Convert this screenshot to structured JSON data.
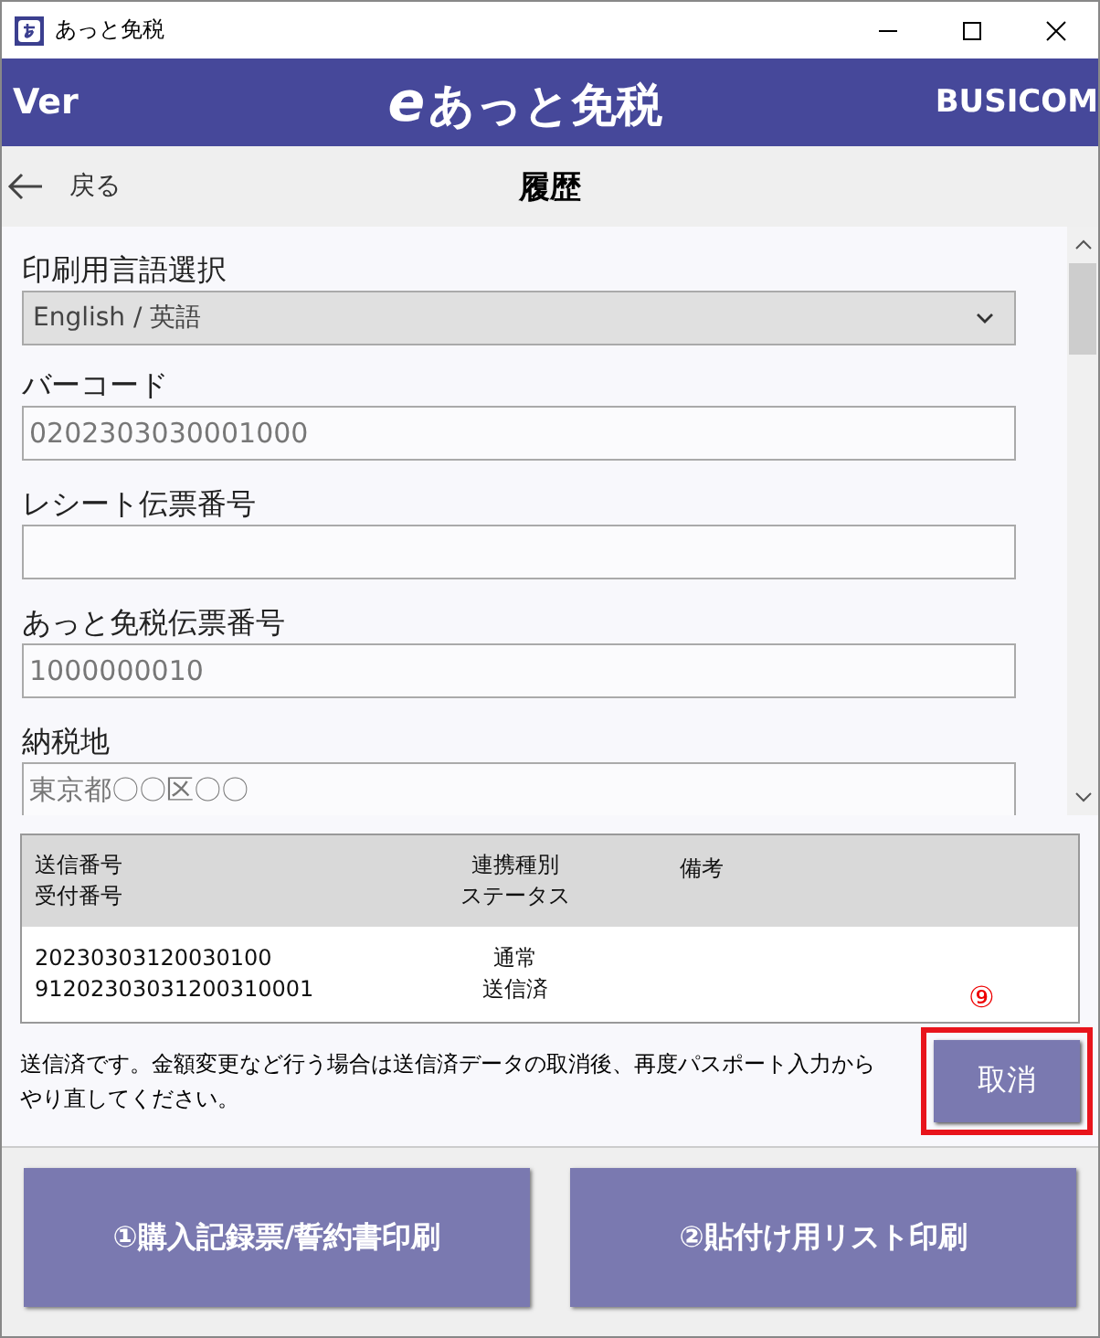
{
  "window": {
    "title": "あっと免税"
  },
  "header": {
    "left": "Ver",
    "logo_mark": "e",
    "logo_text": "あっと免税",
    "right": "BUSICOM"
  },
  "nav": {
    "back": "戻る",
    "title": "履歴"
  },
  "fields": [
    {
      "kind": "select",
      "label": "印刷用言語選択",
      "value": "English / 英語"
    },
    {
      "kind": "text",
      "label": "バーコード",
      "value": "0202303030001000"
    },
    {
      "kind": "text",
      "label": "レシート伝票番号"
    },
    {
      "kind": "text",
      "label": "あっと免税伝票番号",
      "value": "1000000010"
    },
    {
      "kind": "text",
      "label": "納税地",
      "value": "東京都〇〇区〇〇"
    }
  ],
  "history_table": {
    "columns": [
      {
        "line_1": "送信番号",
        "line_2": "受付番号"
      },
      {
        "line_1": "連携種別",
        "line_2": "ステータス"
      },
      {
        "line_1": "備考"
      }
    ],
    "rows": [
      {
        "cells": [
          {
            "line_1": "20230303120030100",
            "line_2": "91202303031200310001"
          },
          {
            "line_1": "通常",
            "line_2": "送信済"
          }
        ]
      }
    ]
  },
  "callout": "⑨",
  "message": "送信済です。金額変更など行う場合は送信済データの取消後、再度パスポート入力からやり直してください。",
  "cancel_button": {
    "label": "取消",
    "highlighted": true
  },
  "actions": [
    "①購入記録票/誓約書印刷",
    "②貼付け用リスト印刷"
  ]
}
